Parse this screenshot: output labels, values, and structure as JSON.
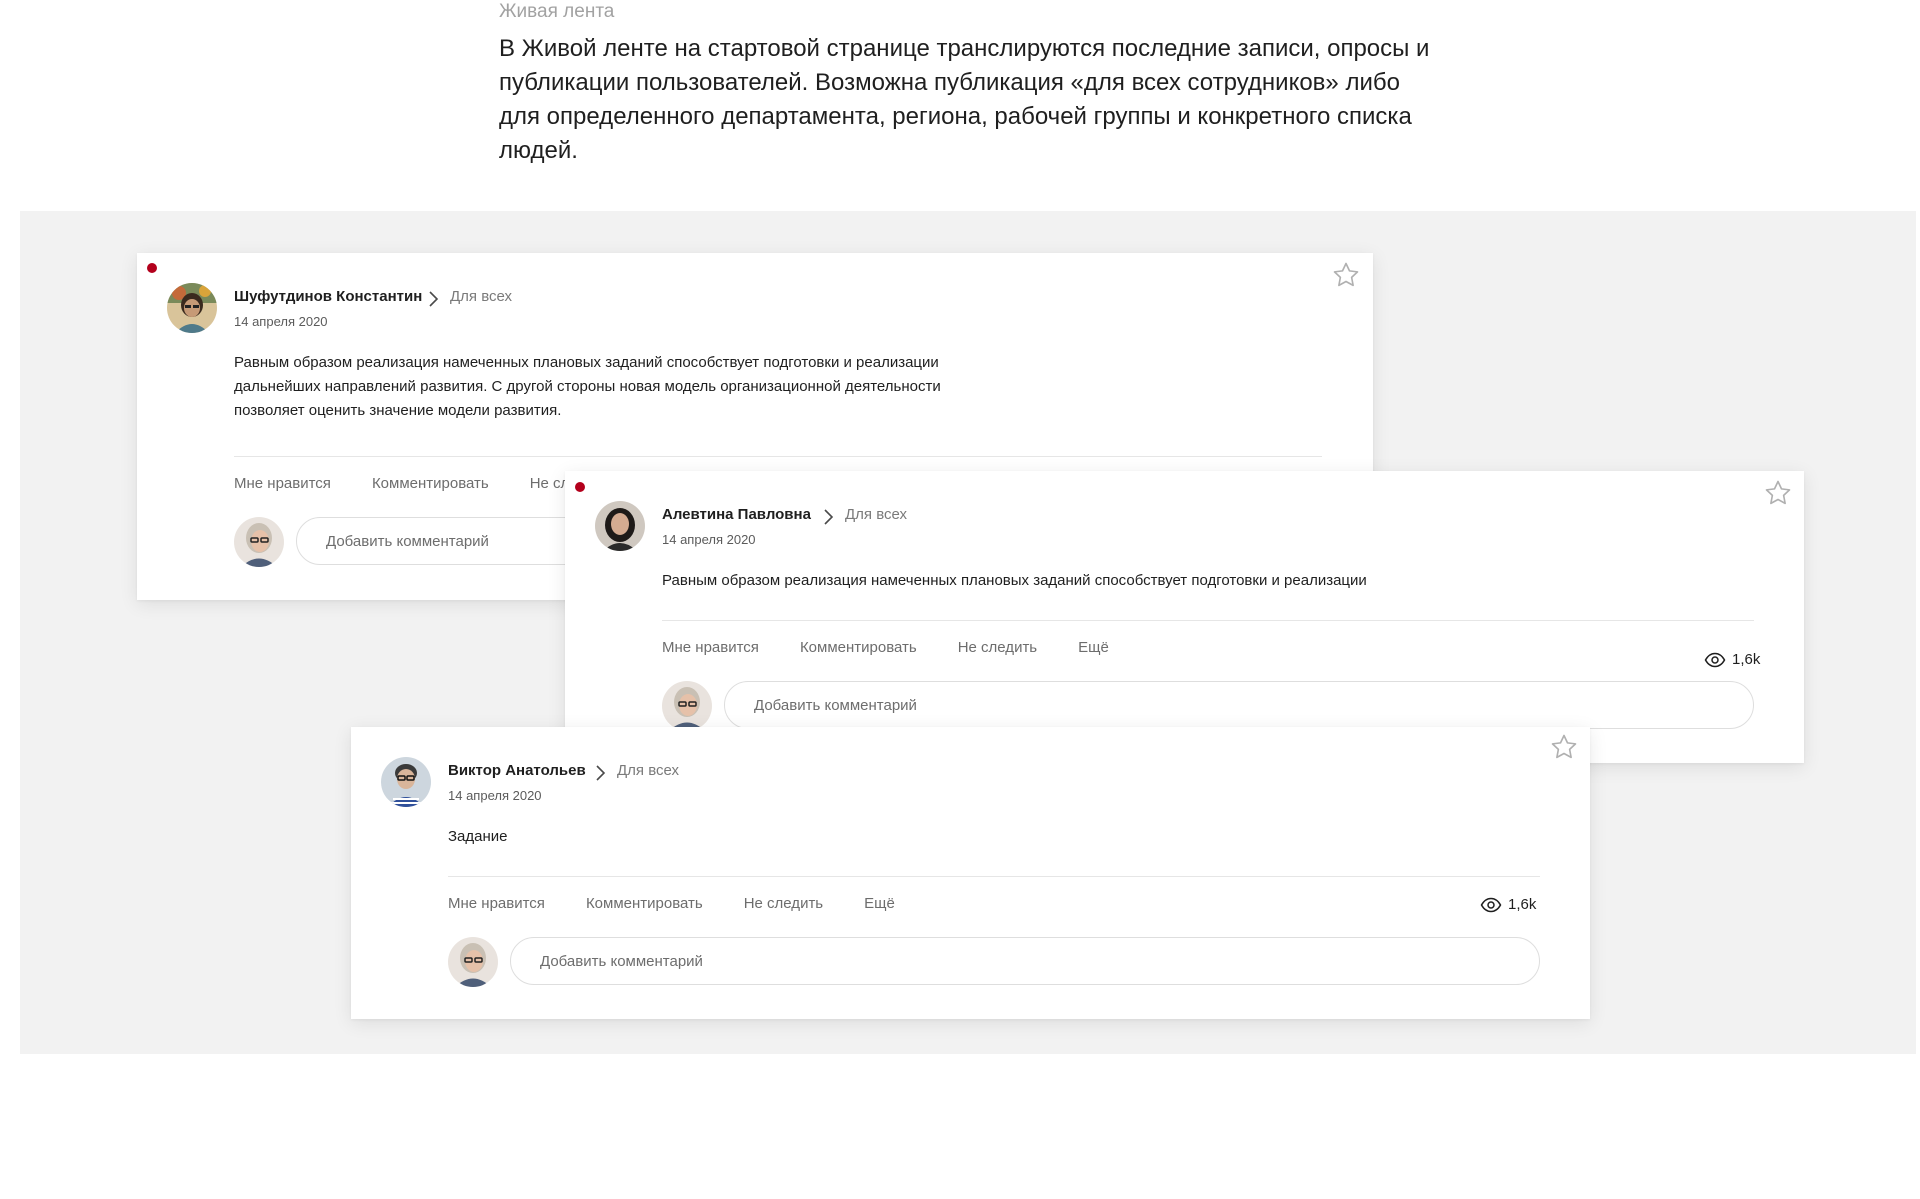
{
  "intro": {
    "label": "Живая лента",
    "text": "В Живой ленте на стартовой странице транслируются последние записи, опросы и публикации пользователей. Возможна публикация «для всех сотрудников» либо для определенного департамента, региона, рабочей группы и конкретного списка людей."
  },
  "icons": {
    "star": "star-outline-icon",
    "chevron": "chevron-right-icon",
    "views": "eye-icon"
  },
  "colors": {
    "unread_dot": "#b3001c",
    "stage_bg": "#f2f2f2"
  },
  "posts": [
    {
      "author": "Шуфутдинов Константин",
      "audience": "Для всех",
      "date": "14 апреля 2020",
      "body": "Равным образом реализация намеченных плановых заданий способствует подготовки и реализации дальнейших направлений развития. С другой стороны новая модель организационной деятельности позволяет оценить значение модели развития.",
      "actions": [
        "Мне нравится",
        "Комментировать",
        "Не следить"
      ],
      "comment_placeholder": "Добавить комментарий"
    },
    {
      "author": "Алевтина Павловна",
      "audience": "Для всех",
      "date": "14 апреля 2020",
      "body": "Равным образом реализация намеченных плановых заданий способствует подготовки и реализации",
      "actions": [
        "Мне нравится",
        "Комментировать",
        "Не следить",
        "Ещё"
      ],
      "views": "1,6k",
      "comment_placeholder": "Добавить комментарий"
    },
    {
      "author": "Виктор Анатольев",
      "audience": "Для всех",
      "date": "14 апреля 2020",
      "body": "Задание",
      "actions": [
        "Мне нравится",
        "Комментировать",
        "Не следить",
        "Ещё"
      ],
      "views": "1,6k",
      "comment_placeholder": "Добавить комментарий"
    }
  ]
}
